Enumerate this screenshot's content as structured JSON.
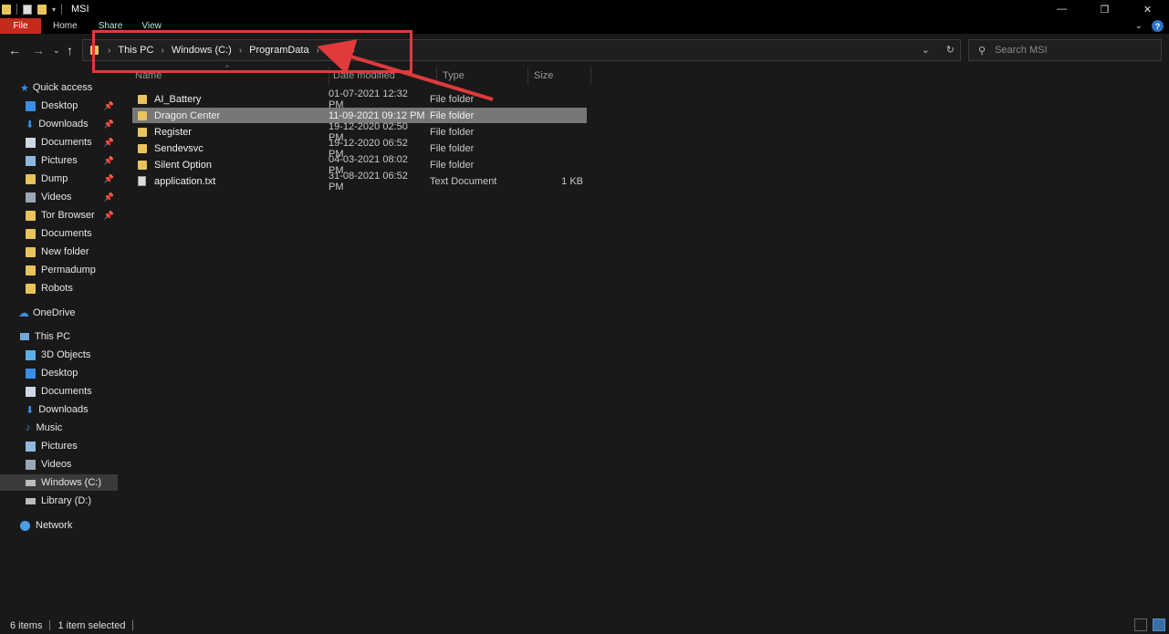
{
  "window": {
    "title": "MSI"
  },
  "ribbon": {
    "tabs": [
      "File",
      "Home",
      "Share",
      "View"
    ]
  },
  "address": {
    "crumbs": [
      "This PC",
      "Windows (C:)",
      "ProgramData",
      "MSI"
    ]
  },
  "search": {
    "placeholder": "Search MSI"
  },
  "sidebar": {
    "quick_access": "Quick access",
    "quick_items": [
      "Desktop",
      "Downloads",
      "Documents",
      "Pictures",
      "Dump",
      "Videos",
      "Tor Browser",
      "Documents",
      "New folder",
      "Permadump",
      "Robots"
    ],
    "onedrive": "OneDrive",
    "this_pc": "This PC",
    "pc_items": [
      "3D Objects",
      "Desktop",
      "Documents",
      "Downloads",
      "Music",
      "Pictures",
      "Videos",
      "Windows (C:)",
      "Library (D:)"
    ],
    "network": "Network"
  },
  "columns": {
    "name": "Name",
    "date": "Date modified",
    "type": "Type",
    "size": "Size"
  },
  "files": [
    {
      "name": "AI_Battery",
      "date": "01-07-2021 12:32 PM",
      "type": "File folder",
      "size": ""
    },
    {
      "name": "Dragon Center",
      "date": "11-09-2021 09:12 PM",
      "type": "File folder",
      "size": ""
    },
    {
      "name": "Register",
      "date": "19-12-2020 02:50 PM",
      "type": "File folder",
      "size": ""
    },
    {
      "name": "Sendevsvc",
      "date": "19-12-2020 06:52 PM",
      "type": "File folder",
      "size": ""
    },
    {
      "name": "Silent Option",
      "date": "04-03-2021 08:02 PM",
      "type": "File folder",
      "size": ""
    },
    {
      "name": "application.txt",
      "date": "31-08-2021 06:52 PM",
      "type": "Text Document",
      "size": "1 KB"
    }
  ],
  "status": {
    "items": "6 items",
    "selected": "1 item selected"
  },
  "colors": {
    "file_tab": "#c42b1c",
    "selection": "#777777",
    "annotation": "#e03a3a"
  }
}
